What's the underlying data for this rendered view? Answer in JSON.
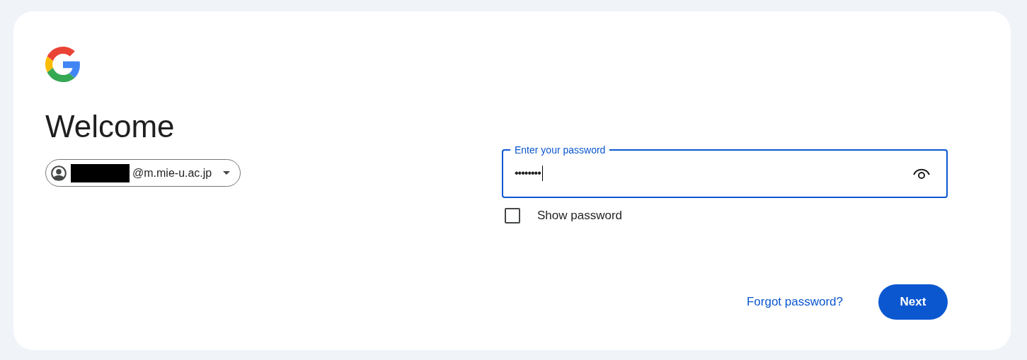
{
  "heading": "Welcome",
  "account_chip": {
    "email": "@m.mie-u.ac.jp",
    "redacted": true
  },
  "password_field": {
    "label": "Enter your password",
    "value": "••••••••",
    "focused": true
  },
  "show_password": {
    "label": "Show password",
    "checked": false
  },
  "links": {
    "forgot_password": "Forgot password?"
  },
  "buttons": {
    "next": "Next"
  }
}
